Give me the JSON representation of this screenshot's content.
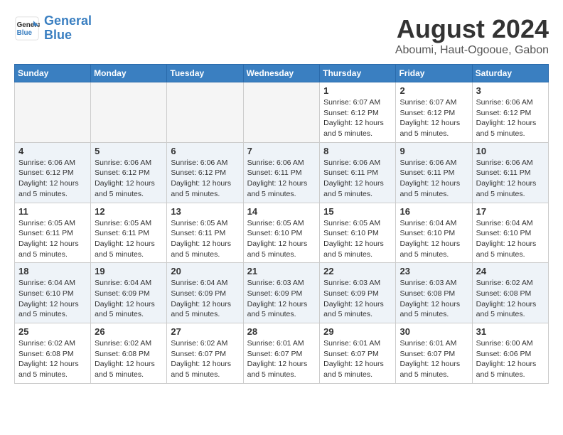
{
  "header": {
    "logo_line1": "General",
    "logo_line2": "Blue",
    "month": "August 2024",
    "location": "Aboumi, Haut-Ogooue, Gabon"
  },
  "weekdays": [
    "Sunday",
    "Monday",
    "Tuesday",
    "Wednesday",
    "Thursday",
    "Friday",
    "Saturday"
  ],
  "weeks": [
    [
      {
        "day": "",
        "info": ""
      },
      {
        "day": "",
        "info": ""
      },
      {
        "day": "",
        "info": ""
      },
      {
        "day": "",
        "info": ""
      },
      {
        "day": "1",
        "info": "Sunrise: 6:07 AM\nSunset: 6:12 PM\nDaylight: 12 hours\nand 5 minutes."
      },
      {
        "day": "2",
        "info": "Sunrise: 6:07 AM\nSunset: 6:12 PM\nDaylight: 12 hours\nand 5 minutes."
      },
      {
        "day": "3",
        "info": "Sunrise: 6:06 AM\nSunset: 6:12 PM\nDaylight: 12 hours\nand 5 minutes."
      }
    ],
    [
      {
        "day": "4",
        "info": "Sunrise: 6:06 AM\nSunset: 6:12 PM\nDaylight: 12 hours\nand 5 minutes."
      },
      {
        "day": "5",
        "info": "Sunrise: 6:06 AM\nSunset: 6:12 PM\nDaylight: 12 hours\nand 5 minutes."
      },
      {
        "day": "6",
        "info": "Sunrise: 6:06 AM\nSunset: 6:12 PM\nDaylight: 12 hours\nand 5 minutes."
      },
      {
        "day": "7",
        "info": "Sunrise: 6:06 AM\nSunset: 6:11 PM\nDaylight: 12 hours\nand 5 minutes."
      },
      {
        "day": "8",
        "info": "Sunrise: 6:06 AM\nSunset: 6:11 PM\nDaylight: 12 hours\nand 5 minutes."
      },
      {
        "day": "9",
        "info": "Sunrise: 6:06 AM\nSunset: 6:11 PM\nDaylight: 12 hours\nand 5 minutes."
      },
      {
        "day": "10",
        "info": "Sunrise: 6:06 AM\nSunset: 6:11 PM\nDaylight: 12 hours\nand 5 minutes."
      }
    ],
    [
      {
        "day": "11",
        "info": "Sunrise: 6:05 AM\nSunset: 6:11 PM\nDaylight: 12 hours\nand 5 minutes."
      },
      {
        "day": "12",
        "info": "Sunrise: 6:05 AM\nSunset: 6:11 PM\nDaylight: 12 hours\nand 5 minutes."
      },
      {
        "day": "13",
        "info": "Sunrise: 6:05 AM\nSunset: 6:11 PM\nDaylight: 12 hours\nand 5 minutes."
      },
      {
        "day": "14",
        "info": "Sunrise: 6:05 AM\nSunset: 6:10 PM\nDaylight: 12 hours\nand 5 minutes."
      },
      {
        "day": "15",
        "info": "Sunrise: 6:05 AM\nSunset: 6:10 PM\nDaylight: 12 hours\nand 5 minutes."
      },
      {
        "day": "16",
        "info": "Sunrise: 6:04 AM\nSunset: 6:10 PM\nDaylight: 12 hours\nand 5 minutes."
      },
      {
        "day": "17",
        "info": "Sunrise: 6:04 AM\nSunset: 6:10 PM\nDaylight: 12 hours\nand 5 minutes."
      }
    ],
    [
      {
        "day": "18",
        "info": "Sunrise: 6:04 AM\nSunset: 6:10 PM\nDaylight: 12 hours\nand 5 minutes."
      },
      {
        "day": "19",
        "info": "Sunrise: 6:04 AM\nSunset: 6:09 PM\nDaylight: 12 hours\nand 5 minutes."
      },
      {
        "day": "20",
        "info": "Sunrise: 6:04 AM\nSunset: 6:09 PM\nDaylight: 12 hours\nand 5 minutes."
      },
      {
        "day": "21",
        "info": "Sunrise: 6:03 AM\nSunset: 6:09 PM\nDaylight: 12 hours\nand 5 minutes."
      },
      {
        "day": "22",
        "info": "Sunrise: 6:03 AM\nSunset: 6:09 PM\nDaylight: 12 hours\nand 5 minutes."
      },
      {
        "day": "23",
        "info": "Sunrise: 6:03 AM\nSunset: 6:08 PM\nDaylight: 12 hours\nand 5 minutes."
      },
      {
        "day": "24",
        "info": "Sunrise: 6:02 AM\nSunset: 6:08 PM\nDaylight: 12 hours\nand 5 minutes."
      }
    ],
    [
      {
        "day": "25",
        "info": "Sunrise: 6:02 AM\nSunset: 6:08 PM\nDaylight: 12 hours\nand 5 minutes."
      },
      {
        "day": "26",
        "info": "Sunrise: 6:02 AM\nSunset: 6:08 PM\nDaylight: 12 hours\nand 5 minutes."
      },
      {
        "day": "27",
        "info": "Sunrise: 6:02 AM\nSunset: 6:07 PM\nDaylight: 12 hours\nand 5 minutes."
      },
      {
        "day": "28",
        "info": "Sunrise: 6:01 AM\nSunset: 6:07 PM\nDaylight: 12 hours\nand 5 minutes."
      },
      {
        "day": "29",
        "info": "Sunrise: 6:01 AM\nSunset: 6:07 PM\nDaylight: 12 hours\nand 5 minutes."
      },
      {
        "day": "30",
        "info": "Sunrise: 6:01 AM\nSunset: 6:07 PM\nDaylight: 12 hours\nand 5 minutes."
      },
      {
        "day": "31",
        "info": "Sunrise: 6:00 AM\nSunset: 6:06 PM\nDaylight: 12 hours\nand 5 minutes."
      }
    ]
  ]
}
